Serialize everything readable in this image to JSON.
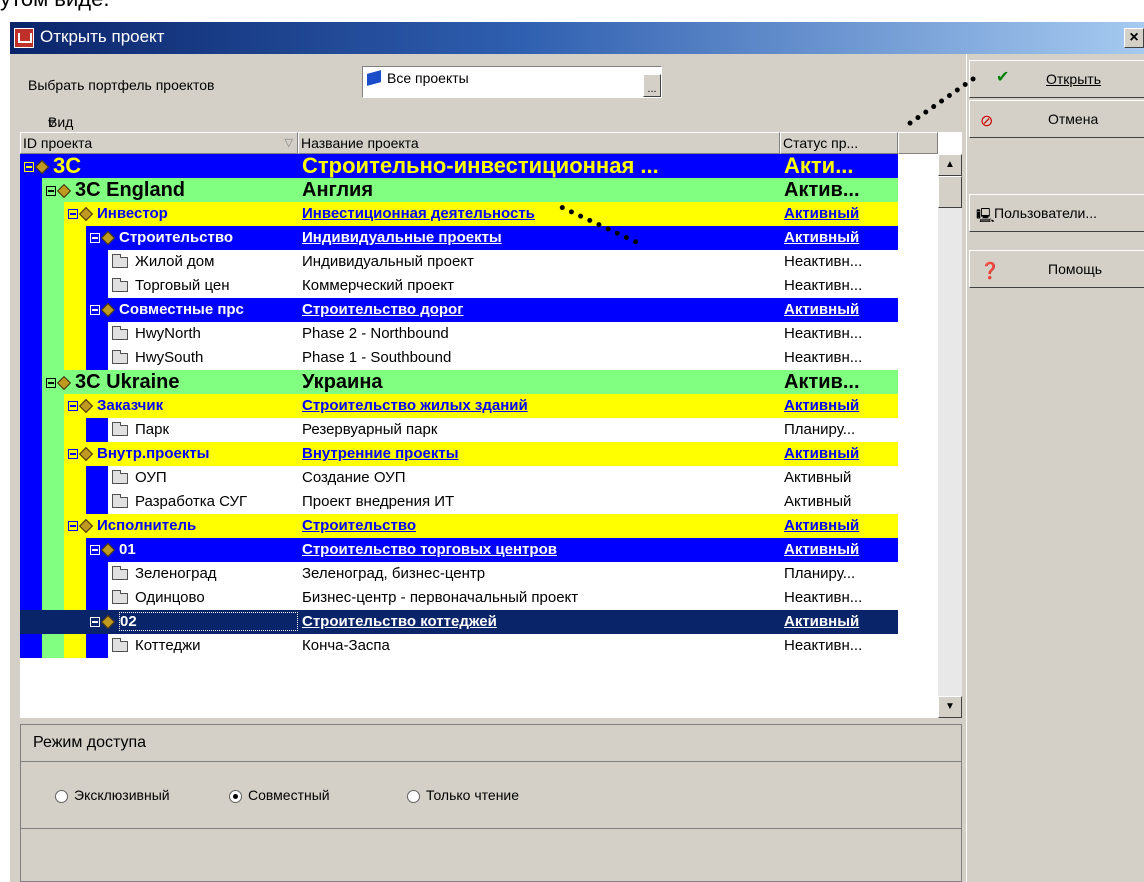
{
  "top_text": "утом виде.",
  "dialog": {
    "title": "Открыть проект",
    "close": "×"
  },
  "portfolio": {
    "label": "Выбрать портфель проектов",
    "value": "Все проекты",
    "browse": "..."
  },
  "grid": {
    "view_label": "Вид",
    "columns": [
      "ID проекта",
      "Название проекта",
      "Статус пр..."
    ],
    "rows": [
      {
        "id": "3C",
        "name": "Строительно-инвестиционная ...",
        "status": "Акти...",
        "level": 0,
        "kind": "node"
      },
      {
        "id": "3C England",
        "name": "Англия",
        "status": "Актив...",
        "level": 1,
        "kind": "node"
      },
      {
        "id": "Инвестор",
        "name": "Инвестиционная деятельность",
        "status": "Активный",
        "level": 2,
        "kind": "node"
      },
      {
        "id": "Строительство",
        "name": "Индивидуальные проекты",
        "status": "Активный",
        "level": 3,
        "kind": "node"
      },
      {
        "id": "Жилой дом",
        "name": "Индивидуальный проект",
        "status": "Неактивн...",
        "level": 4,
        "kind": "leaf"
      },
      {
        "id": "Торговый цен",
        "name": "Коммерческий проект",
        "status": "Неактивн...",
        "level": 4,
        "kind": "leaf"
      },
      {
        "id": "Совместные прс",
        "name": "Строительство дорог",
        "status": "Активный",
        "level": 3,
        "kind": "node"
      },
      {
        "id": "HwyNorth",
        "name": "Phase 2 - Northbound",
        "status": "Неактивн...",
        "level": 4,
        "kind": "leaf"
      },
      {
        "id": "HwySouth",
        "name": "Phase 1 - Southbound",
        "status": "Неактивн...",
        "level": 4,
        "kind": "leaf"
      },
      {
        "id": "3C Ukraine",
        "name": "Украина",
        "status": "Актив...",
        "level": 1,
        "kind": "node"
      },
      {
        "id": "Заказчик",
        "name": "Строительство жилых зданий",
        "status": "Активный",
        "level": 2,
        "kind": "node"
      },
      {
        "id": "Парк",
        "name": "Резервуарный парк",
        "status": "Планиру...",
        "level": 3,
        "kind": "leaf"
      },
      {
        "id": "Внутр.проекты",
        "name": "Внутренние проекты",
        "status": "Активный",
        "level": 2,
        "kind": "node"
      },
      {
        "id": "ОУП",
        "name": "Создание ОУП",
        "status": "Активный",
        "level": 3,
        "kind": "leaf"
      },
      {
        "id": "Разработка СУГ",
        "name": "Проект внедрения ИТ",
        "status": "Активный",
        "level": 3,
        "kind": "leaf"
      },
      {
        "id": "Исполнитель",
        "name": "Строительство",
        "status": "Активный",
        "level": 2,
        "kind": "node"
      },
      {
        "id": "01",
        "name": "Строительство торговых центров",
        "status": "Активный",
        "level": 3,
        "kind": "node"
      },
      {
        "id": "Зеленоград",
        "name": "Зеленоград, бизнес-центр",
        "status": "Планиру...",
        "level": 4,
        "kind": "leaf"
      },
      {
        "id": "Одинцово",
        "name": "Бизнес-центр - первоначальный проект",
        "status": "Неактивн...",
        "level": 4,
        "kind": "leaf"
      },
      {
        "id": "02",
        "name": "Строительство коттеджей",
        "status": "Активный",
        "level": 3,
        "kind": "node",
        "selected": true
      },
      {
        "id": "Коттеджи",
        "name": "Конча-Заспа",
        "status": "Неактивн...",
        "level": 4,
        "kind": "leaf"
      }
    ]
  },
  "access": {
    "title": "Режим доступа",
    "options": [
      "Эксклюзивный",
      "Совместный",
      "Только чтение"
    ],
    "selected": "Совместный"
  },
  "buttons": {
    "open": "Открыть",
    "cancel": "Отмена",
    "users": "Пользователи...",
    "help": "Помощь"
  },
  "colors": {
    "level0": "#0000ff",
    "level1": "#80ff80",
    "level2": "#ffff00",
    "level3": "#0000ff",
    "selected": "#0a246a"
  }
}
